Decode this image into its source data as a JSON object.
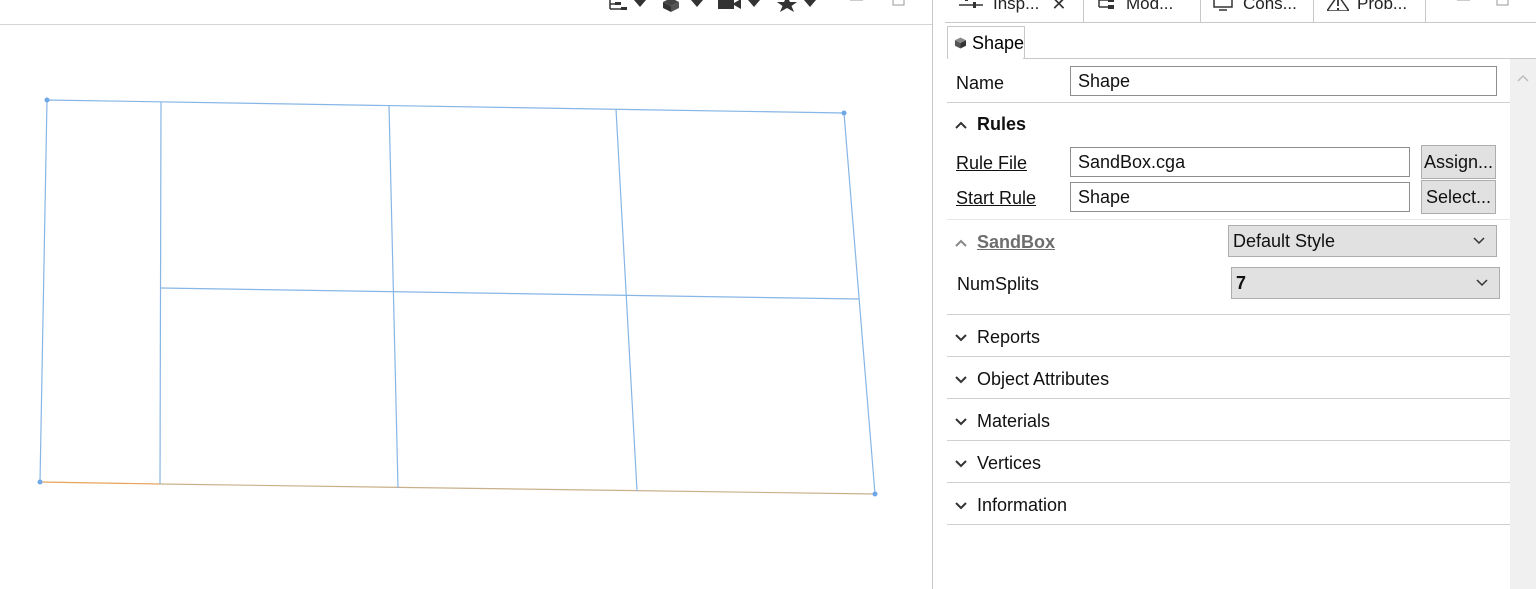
{
  "viewport": {
    "toolbar_icons": [
      "layers-icon",
      "cube-view-icon",
      "camera-icon",
      "star-bookmark-icon"
    ]
  },
  "panel": {
    "tabs": [
      {
        "label": "Insp...",
        "icon": "inspector-icon",
        "active": true
      },
      {
        "label": "Mod...",
        "icon": "model-hierarchy-icon",
        "active": false
      },
      {
        "label": "Cons...",
        "icon": "console-icon",
        "active": false
      },
      {
        "label": "Prob...",
        "icon": "warning-icon",
        "active": false
      }
    ],
    "subtab": {
      "label": "Shape",
      "icon": "shape-cube-icon"
    },
    "name": {
      "label": "Name",
      "value": "Shape"
    },
    "rules": {
      "title": "Rules",
      "rule_file": {
        "label": "Rule File",
        "value": "SandBox.cga",
        "button": "Assign..."
      },
      "start_rule": {
        "label": "Start Rule",
        "value": "Shape",
        "button": "Select..."
      }
    },
    "sandbox": {
      "title": "SandBox",
      "style": "Default Style",
      "num_splits": {
        "label": "NumSplits",
        "value": "7"
      }
    },
    "sections": [
      "Reports",
      "Object Attributes",
      "Materials",
      "Vertices",
      "Information"
    ]
  },
  "colors": {
    "edge": "#87b6e6",
    "edge_orange": "#e8a25a",
    "vertex": "#6fa8e6"
  }
}
